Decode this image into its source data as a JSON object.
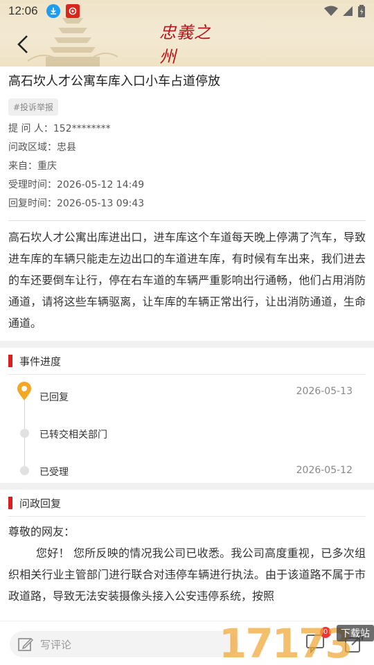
{
  "status_bar": {
    "time": "12:06"
  },
  "header": {
    "logo_text": "忠義之州"
  },
  "article": {
    "title": "高石坎人才公寓车库入口小车占道停放",
    "tag": "#投诉举报",
    "meta": {
      "asker": "提  问 人：152********",
      "region": "问政区域：忠县",
      "source": "来自：重庆",
      "accepted": "受理时间：2026-05-12 14:49",
      "replied": "回复时间：2026-05-13 09:43"
    },
    "body": "高石坎人才公寓出库进出口，进车库这个车道每天晚上停满了汽车，导致进车库的车辆只能走左边出口的车道进车库，有时候有车出来，我们进去的车还要倒车让行，停在右车道的车辆严重影响出行通畅，他们占用消防通道，请将这些车辆驱离，让车库的车辆正常出行，让出消防通道，生命通道。"
  },
  "progress": {
    "title": "事件进度",
    "steps": [
      {
        "label": "已回复",
        "date": "2026-05-13"
      },
      {
        "label": "已转交相关部门",
        "date": ""
      },
      {
        "label": "已受理",
        "date": "2026-05-12"
      }
    ]
  },
  "reply": {
    "title": "问政回复",
    "greeting": "尊敬的网友：",
    "text": "您好！ 您所反映的情况我公司已收悉。我公司高度重视，已多次组织相关行业主管部门进行联合对违停车辆进行执法。由于该道路不属于市政道路，导致无法安装摄像头接入公安违停系统，按照"
  },
  "bottom_bar": {
    "comment_placeholder": "写评论",
    "message_count": "0"
  },
  "watermark": {
    "number": "17173",
    "label": "下载站"
  },
  "colors": {
    "accent_red": "#d81e1e",
    "pin_orange": "#f5a623",
    "header_bg": "#efe3c8"
  }
}
